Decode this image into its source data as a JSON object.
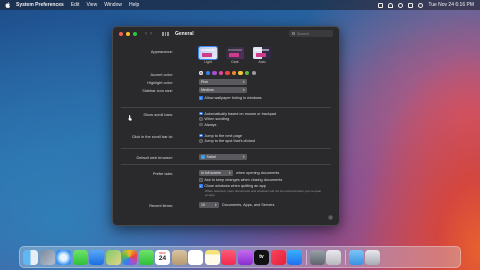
{
  "menubar": {
    "apple_icon": "apple-icon",
    "app_name": "System Preferences",
    "menus": [
      "Edit",
      "View",
      "Window",
      "Help"
    ],
    "datetime": "Tue Nov 24  6:16 PM"
  },
  "window": {
    "title": "General",
    "search_placeholder": "Search",
    "appearance": {
      "label": "Appearance:",
      "options": [
        "Light",
        "Dark",
        "Auto"
      ]
    },
    "accent_color": {
      "label": "Accent color:",
      "swatches": [
        "#9a9aa0",
        "#2f7ff2",
        "#a64fd6",
        "#e24a96",
        "#e8453c",
        "#f0892c",
        "#f2c73a",
        "#5dbb46",
        "#9a9aa0"
      ]
    },
    "highlight_color": {
      "label": "Highlight color:",
      "value": "Pink"
    },
    "sidebar_icon_size": {
      "label": "Sidebar icon size:",
      "value": "Medium"
    },
    "wallpaper_tinting": "Allow wallpaper tinting in windows",
    "show_scroll_bars": {
      "label": "Show scroll bars:",
      "options": [
        "Automatically based on mouse or trackpad",
        "When scrolling",
        "Always"
      ]
    },
    "click_scroll_bar": {
      "label": "Click in the scroll bar to:",
      "options": [
        "Jump to the next page",
        "Jump to the spot that's clicked"
      ]
    },
    "default_browser": {
      "label": "Default web browser:",
      "value": "Safari"
    },
    "prefer_tabs": {
      "label": "Prefer tabs:",
      "value": "in full screen",
      "suffix": "when opening documents"
    },
    "ask_keep_changes": "Ask to keep changes when closing documents",
    "close_windows": "Close windows when quitting an app",
    "close_windows_note": "When selected, open documents and windows will not be restored when you re-open an app.",
    "recent_items": {
      "label": "Recent items:",
      "value": "10",
      "suffix": "Documents, Apps, and Servers"
    },
    "help": "?"
  },
  "dock": {
    "apps": [
      "Finder",
      "Launchpad",
      "Safari",
      "Messages",
      "Mail",
      "Maps",
      "Photos",
      "FaceTime",
      "Calendar",
      "Contacts",
      "Reminders",
      "Notes",
      "Music",
      "Podcasts",
      "TV",
      "News",
      "App Store",
      "System Preferences",
      "Screenshot"
    ],
    "calendar_day": "24",
    "calendar_month": "NOV",
    "tv_label": "tv"
  }
}
